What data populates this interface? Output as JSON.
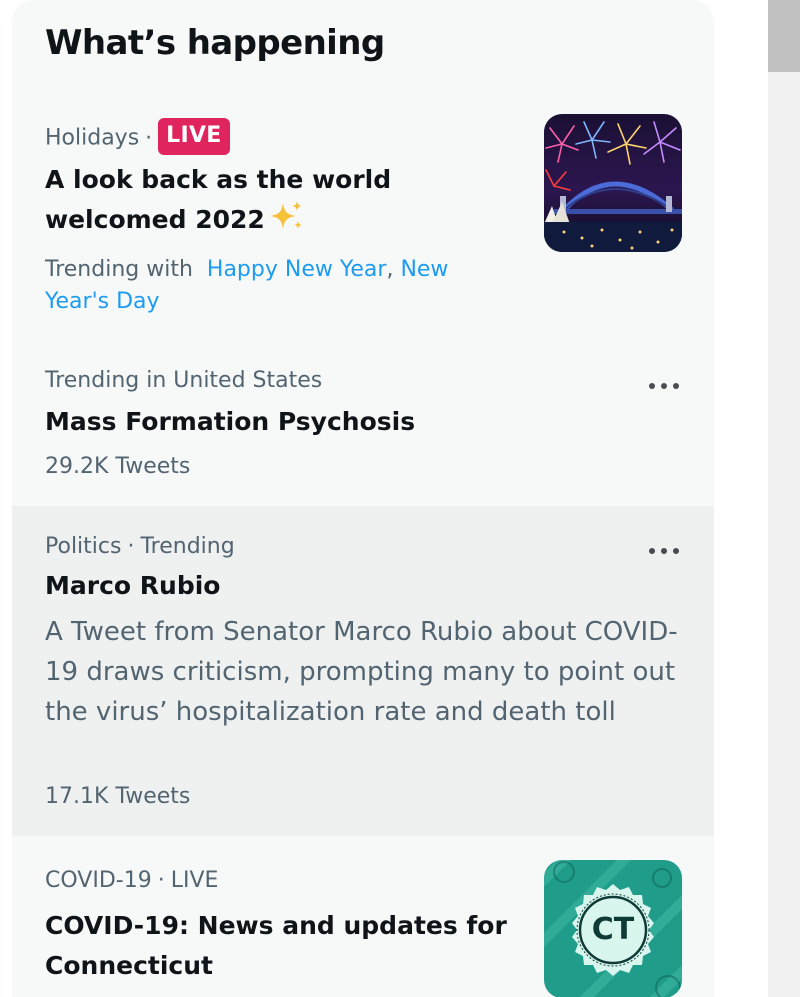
{
  "panel": {
    "title": "What’s happening"
  },
  "trends": [
    {
      "category": "Holidays",
      "separator": "·",
      "badge": "LIVE",
      "headline_line1": "A look back as the world",
      "headline_line2": "welcomed 2022",
      "emoji_icon": "sparkles-icon",
      "context_prefix": "Trending with",
      "context_links": [
        "Happy New Year",
        "New Year's Day"
      ],
      "context_comma": ",",
      "thumbnail": "fireworks-harbour-bridge-image"
    },
    {
      "category": "Trending in United States",
      "headline": "Mass Formation Psychosis",
      "count": "29.2K Tweets",
      "more_icon": "more-horizontal-icon"
    },
    {
      "category": "Politics",
      "separator": "·",
      "status": "Trending",
      "headline": "Marco Rubio",
      "description": "A Tweet from Senator Marco Rubio about COVID-19 draws criticism, prompting many to point out the virus’ hospitalization rate and death toll",
      "count": "17.1K Tweets",
      "more_icon": "more-horizontal-icon"
    },
    {
      "category": "COVID-19",
      "separator": "·",
      "status": "LIVE",
      "headline_line1": "COVID-19: News and updates for",
      "headline_line2": "Connecticut",
      "thumbnail_text": "CT"
    }
  ],
  "colors": {
    "panel_bg": "#f7f9f9",
    "hover_bg": "#eff1f1",
    "text_primary": "#0f1419",
    "text_secondary": "#536471",
    "link": "#1d9bf0",
    "live_badge": "#e0245e",
    "ct_teal": "#1f9d8a"
  }
}
